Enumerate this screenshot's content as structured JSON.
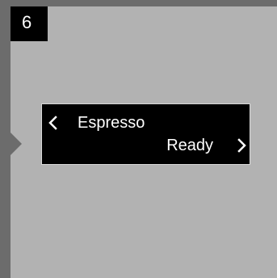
{
  "step": {
    "number": "6"
  },
  "display": {
    "line1": "Espresso",
    "line2": "Ready",
    "prev_icon": "chevron-left-icon",
    "next_icon": "chevron-right-icon"
  },
  "colors": {
    "frame": "#6c6c6c",
    "panel": "#b2b2b2",
    "display_bg": "#000000",
    "display_text": "#ffffff"
  }
}
